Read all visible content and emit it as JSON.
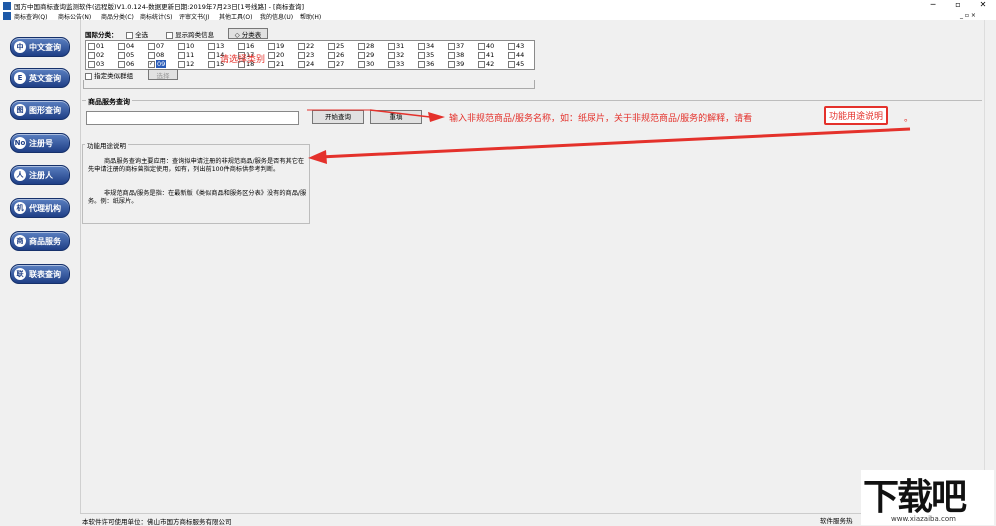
{
  "titlebar": {
    "title": "国方中国商标查询监测软件(远程版)V1.0.124-数据更新日期:2019年7月23日[1号线路] - [商标查询]",
    "minimize": "─",
    "maximize": "▫",
    "close": "✕"
  },
  "menu": {
    "items": [
      "商标查询(Q)",
      "商标公告(N)",
      "商品分类(C)",
      "商标统计(S)",
      "评审文书(J)",
      "其他工具(O)",
      "我的信息(U)",
      "帮助(H)"
    ],
    "mdi_controls": "_ ▫ ×"
  },
  "sidebar": {
    "items": [
      {
        "icon": "中",
        "label": "中文查询"
      },
      {
        "icon": "E",
        "label": "英文查询"
      },
      {
        "icon": "图",
        "label": "图形查询"
      },
      {
        "icon": "No",
        "label": "注册号"
      },
      {
        "icon": "人",
        "label": "注册人"
      },
      {
        "icon": "机",
        "label": "代理机构"
      },
      {
        "icon": "商",
        "label": "商品服务"
      },
      {
        "icon": "联",
        "label": "联表查询"
      }
    ]
  },
  "classification": {
    "label": "国际分类：",
    "select_all": "全选",
    "show_cross": "显示跨类信息",
    "class_table_button": "分类表",
    "classes": [
      "01",
      "02",
      "03",
      "04",
      "05",
      "06",
      "07",
      "08",
      "09",
      "10",
      "11",
      "12",
      "13",
      "14",
      "15",
      "16",
      "17",
      "18",
      "19",
      "20",
      "21",
      "22",
      "23",
      "24",
      "25",
      "26",
      "27",
      "28",
      "29",
      "30",
      "31",
      "32",
      "33",
      "34",
      "35",
      "36",
      "37",
      "38",
      "39",
      "40",
      "41",
      "42",
      "43",
      "44",
      "45"
    ],
    "selected": "09",
    "specified_group_label": "指定类似群组",
    "select_button": "选择",
    "hint_red": "请选择类别"
  },
  "service_query": {
    "legend": "商品服务查询",
    "input_value": "",
    "start_button": "开始查询",
    "reset_button": "重填"
  },
  "usage": {
    "legend": "功能用途说明",
    "para1": "商品服务查询主要应用：查询拟申请注册的非规范商品/服务是否有其它在先申请注册的商标曾指定使用，如有，列出前100件商标供参考判断。",
    "para2": "非规范商品/服务是指：在最新版《类似商品和服务区分表》没有的商品/服务。例：纸尿片。"
  },
  "annotation": {
    "text": "输入非规范商品/服务名称，如：纸尿片，关于非规范商品/服务的解释，请看",
    "boxed": "功能用途说明",
    "suffix": "。"
  },
  "status": {
    "licensee": "本软件许可使用单位：佛山市国方商标服务有限公司",
    "right": "软件服务热"
  },
  "watermark": {
    "big": "下载吧",
    "url": "www.xiazaiba.com"
  },
  "colors": {
    "accent_red": "#e4312b",
    "nav_blue": "#1f3f86"
  }
}
